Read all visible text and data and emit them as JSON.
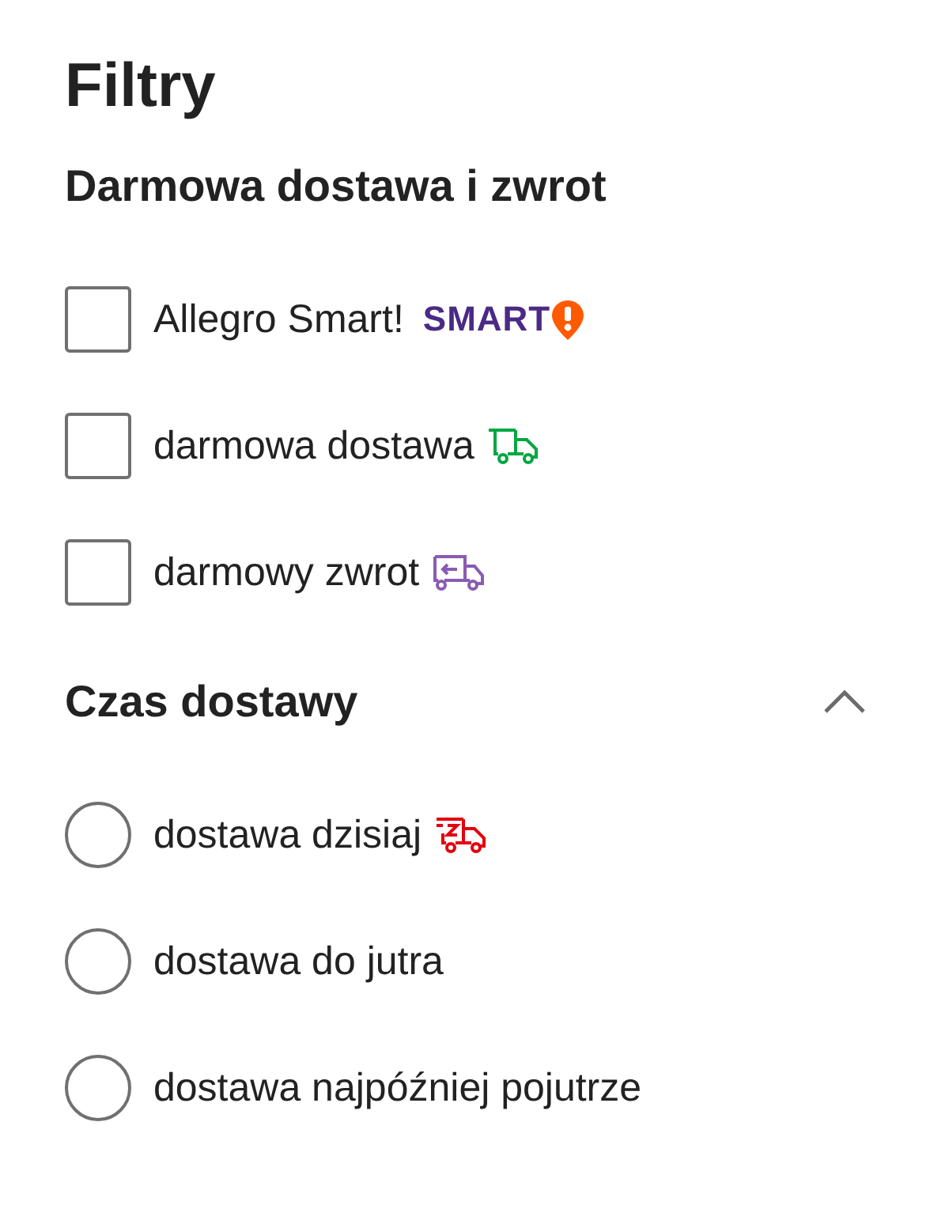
{
  "title": "Filtry",
  "sections": [
    {
      "heading": "Darmowa dostawa i zwrot",
      "kind": "checkbox",
      "options": [
        {
          "label": "Allegro Smart!",
          "checked": false,
          "kind": "smart",
          "badge": "SMART"
        },
        {
          "label": "darmowa dostawa",
          "checked": false,
          "kind": "truck"
        },
        {
          "label": "darmowy zwrot",
          "checked": false,
          "kind": "return"
        }
      ]
    },
    {
      "heading": "Czas dostawy",
      "kind": "radio",
      "expanded": true,
      "options": [
        {
          "label": "dostawa dzisiaj",
          "selected": false,
          "kind": "fast-truck"
        },
        {
          "label": "dostawa do jutra",
          "selected": false
        },
        {
          "label": "dostawa najpóźniej pojutrze",
          "selected": false
        }
      ]
    }
  ]
}
